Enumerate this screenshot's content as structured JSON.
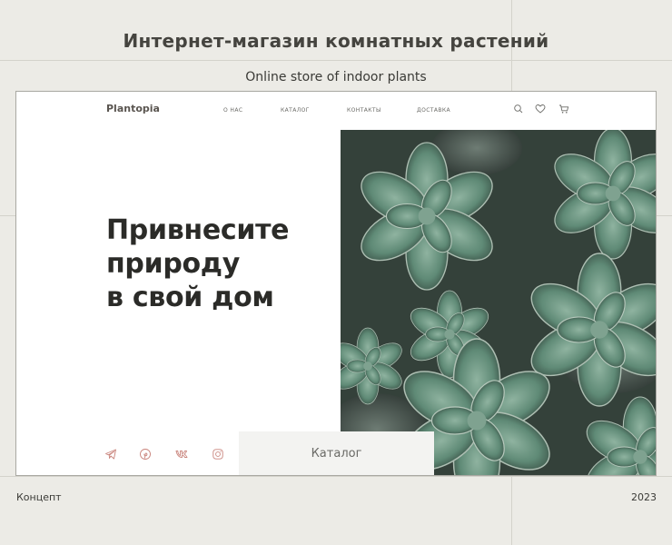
{
  "presentation": {
    "title": "Интернет-магазин комнатных растений",
    "subtitle": "Online store of indoor plants",
    "footer_left": "Концепт",
    "footer_right": "2023"
  },
  "site": {
    "logo": "Plantopia",
    "nav": [
      "О НАС",
      "КАТАЛОГ",
      "КОНТАКТЫ",
      "ДОСТАВКА"
    ],
    "tools": [
      "search-icon",
      "heart-icon",
      "cart-icon"
    ],
    "hero": {
      "lines": [
        "Привнесите",
        "природу",
        "в свой дом"
      ]
    },
    "social": [
      "telegram-icon",
      "pinterest-icon",
      "vk-icon",
      "instagram-icon"
    ],
    "catalog_button": "Каталог",
    "image": "succulent-photo"
  },
  "colors": {
    "background": "#ecebe6",
    "accent": "#c9847c",
    "text": "#2b2b28",
    "leaf": "#5f8a76"
  }
}
